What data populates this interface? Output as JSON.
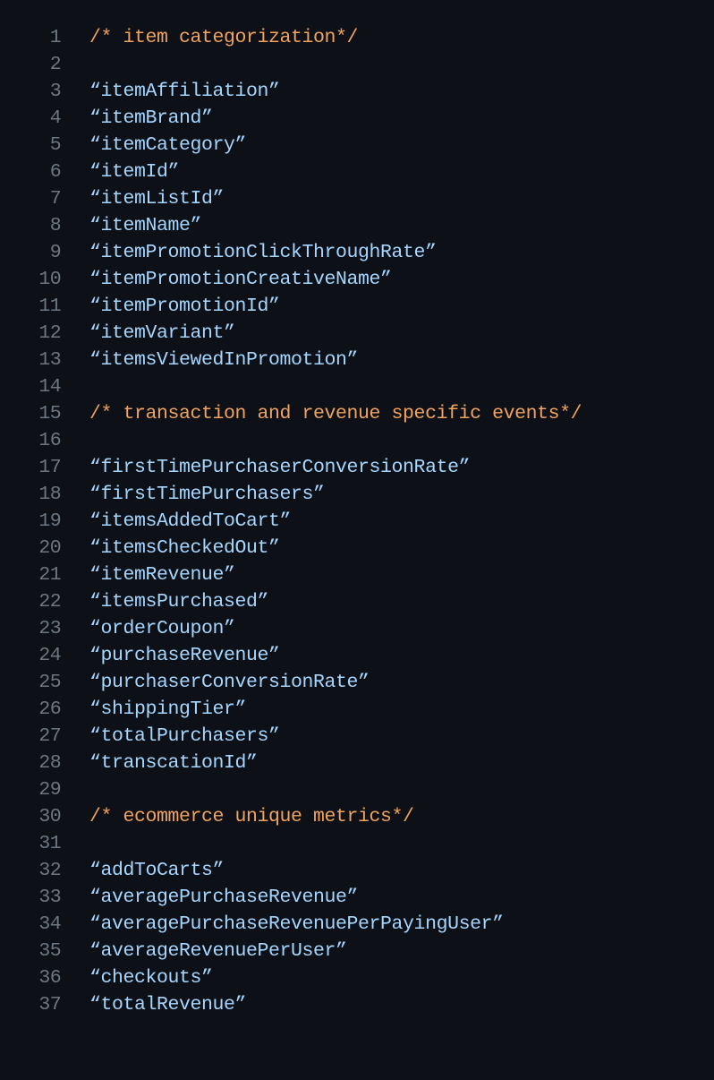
{
  "editor": {
    "colors": {
      "background": "#0d1117",
      "comment": "#f0a35e",
      "string": "#a5d6ff",
      "line_number": "#6e7681"
    },
    "lines": [
      {
        "n": "1",
        "type": "comment",
        "text": "/* item categorization*/"
      },
      {
        "n": "2",
        "type": "blank",
        "text": ""
      },
      {
        "n": "3",
        "type": "string",
        "text": "“itemAffiliation”"
      },
      {
        "n": "4",
        "type": "string",
        "text": "“itemBrand”"
      },
      {
        "n": "5",
        "type": "string",
        "text": "“itemCategory”"
      },
      {
        "n": "6",
        "type": "string",
        "text": "“itemId”"
      },
      {
        "n": "7",
        "type": "string",
        "text": "“itemListId”"
      },
      {
        "n": "8",
        "type": "string",
        "text": "“itemName”"
      },
      {
        "n": "9",
        "type": "string",
        "text": "“itemPromotionClickThroughRate”"
      },
      {
        "n": "10",
        "type": "string",
        "text": "“itemPromotionCreativeName”"
      },
      {
        "n": "11",
        "type": "string",
        "text": "“itemPromotionId”"
      },
      {
        "n": "12",
        "type": "string",
        "text": "“itemVariant”"
      },
      {
        "n": "13",
        "type": "string",
        "text": "“itemsViewedInPromotion”"
      },
      {
        "n": "14",
        "type": "blank",
        "text": ""
      },
      {
        "n": "15",
        "type": "comment",
        "text": "/* transaction and revenue specific events*/"
      },
      {
        "n": "16",
        "type": "blank",
        "text": ""
      },
      {
        "n": "17",
        "type": "string",
        "text": "“firstTimePurchaserConversionRate”"
      },
      {
        "n": "18",
        "type": "string",
        "text": "“firstTimePurchasers”"
      },
      {
        "n": "19",
        "type": "string",
        "text": "“itemsAddedToCart”"
      },
      {
        "n": "20",
        "type": "string",
        "text": "“itemsCheckedOut”"
      },
      {
        "n": "21",
        "type": "string",
        "text": "“itemRevenue”"
      },
      {
        "n": "22",
        "type": "string",
        "text": "“itemsPurchased”"
      },
      {
        "n": "23",
        "type": "string",
        "text": "“orderCoupon”"
      },
      {
        "n": "24",
        "type": "string",
        "text": "“purchaseRevenue”"
      },
      {
        "n": "25",
        "type": "string",
        "text": "“purchaserConversionRate”"
      },
      {
        "n": "26",
        "type": "string",
        "text": "“shippingTier”"
      },
      {
        "n": "27",
        "type": "string",
        "text": "“totalPurchasers”"
      },
      {
        "n": "28",
        "type": "string",
        "text": "“transcationId”"
      },
      {
        "n": "29",
        "type": "blank",
        "text": ""
      },
      {
        "n": "30",
        "type": "comment",
        "text": "/* ecommerce unique metrics*/"
      },
      {
        "n": "31",
        "type": "blank",
        "text": ""
      },
      {
        "n": "32",
        "type": "string",
        "text": "“addToCarts”"
      },
      {
        "n": "33",
        "type": "string",
        "text": "“averagePurchaseRevenue”"
      },
      {
        "n": "34",
        "type": "string",
        "text": "“averagePurchaseRevenuePerPayingUser”"
      },
      {
        "n": "35",
        "type": "string",
        "text": "“averageRevenuePerUser”"
      },
      {
        "n": "36",
        "type": "string",
        "text": "“checkouts”"
      },
      {
        "n": "37",
        "type": "string",
        "text": "“totalRevenue”"
      }
    ]
  }
}
